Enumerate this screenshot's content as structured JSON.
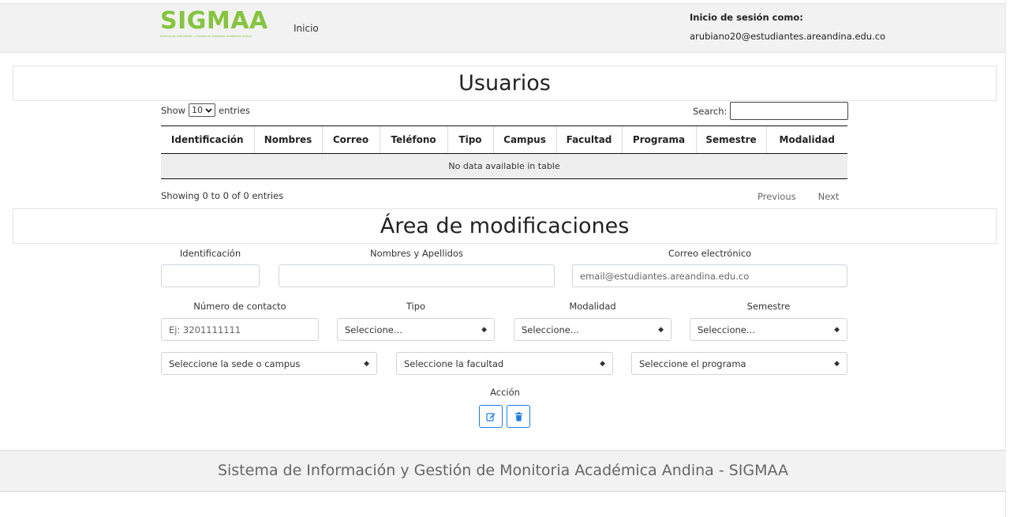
{
  "header": {
    "logo_text": "SIGMAA",
    "logo_subtitle": "Sistema de Información y Gestión de Monitoria Académica Andina",
    "nav_home": "Inicio",
    "login_label": "Inicio de sesión como:",
    "login_email": "arubiano20@estudiantes.areandina.edu.co"
  },
  "users_section": {
    "title": "Usuarios",
    "show_label": "Show",
    "entries_value": "10",
    "entries_label": "entries",
    "search_label": "Search:",
    "columns": [
      "Identificación",
      "Nombres",
      "Correo",
      "Teléfono",
      "Tipo",
      "Campus",
      "Facultad",
      "Programa",
      "Semestre",
      "Modalidad"
    ],
    "empty_message": "No data available in table",
    "info": "Showing 0 to 0 of 0 entries",
    "prev": "Previous",
    "next": "Next"
  },
  "form_section": {
    "title": "Área de modificaciones",
    "id_label": "Identificación",
    "names_label": "Nombres y Apellidos",
    "email_label": "Correo electrónico",
    "email_placeholder": "email@estudiantes.areandina.edu.co",
    "phone_label": "Número de contacto",
    "phone_placeholder": "Ej: 3201111111",
    "tipo_label": "Tipo",
    "tipo_value": "Seleccione...",
    "modalidad_label": "Modalidad",
    "modalidad_value": "Seleccione...",
    "semestre_label": "Semestre",
    "semestre_value": "Seleccione...",
    "campus_value": "Seleccione la sede o campus",
    "facultad_value": "Seleccione la facultad",
    "programa_value": "Seleccione el programa",
    "action_label": "Acción",
    "accent_color": "#1a7be6"
  },
  "footer": {
    "text": "Sistema de Información y Gestión de Monitoria Académica Andina - SIGMAA"
  },
  "icons": {
    "edit": "edit-icon",
    "delete": "trash-icon",
    "select_arrow": "updown-arrow-icon"
  },
  "colors": {
    "brand_green": "#86c440",
    "header_bg": "#f2f2f2",
    "footer_text": "#666666"
  }
}
